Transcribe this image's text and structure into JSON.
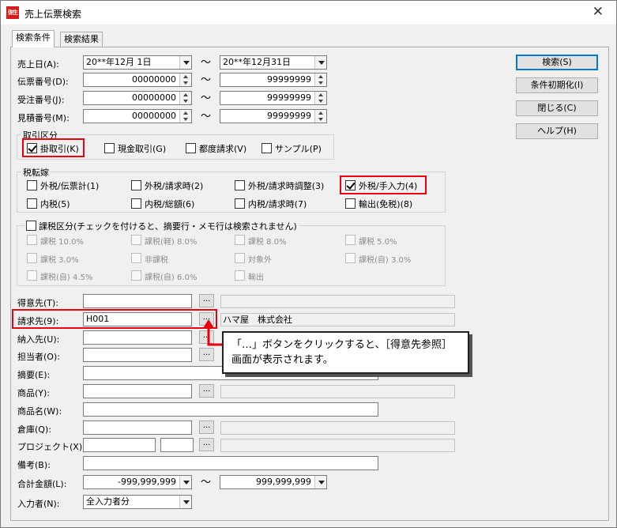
{
  "window": {
    "title": "売上伝票検索",
    "app_icon_text": "弥生",
    "close_symbol": "✕"
  },
  "tabs": [
    {
      "label": "検索条件",
      "active": true
    },
    {
      "label": "検索結果",
      "active": false
    }
  ],
  "range_fields": [
    {
      "label": "売上日(A):",
      "from": "20**年12月 1日",
      "to": "20**年12月31日",
      "type": "combo"
    },
    {
      "label": "伝票番号(D):",
      "from": "00000000",
      "to": "99999999",
      "type": "spin"
    },
    {
      "label": "受注番号(J):",
      "from": "00000000",
      "to": "99999999",
      "type": "spin"
    },
    {
      "label": "見積番号(M):",
      "from": "00000000",
      "to": "99999999",
      "type": "spin"
    }
  ],
  "tilde": "〜",
  "buttons": {
    "search": "検索(S)",
    "reset": "条件初期化(I)",
    "close": "閉じる(C)",
    "help": "ヘルプ(H)"
  },
  "trade_type": {
    "title": "取引区分",
    "options": [
      {
        "label": "掛取引(K)",
        "checked": true
      },
      {
        "label": "現金取引(G)",
        "checked": false
      },
      {
        "label": "都度請求(V)",
        "checked": false
      },
      {
        "label": "サンプル(P)",
        "checked": false
      }
    ]
  },
  "tax_transfer": {
    "title": "税転嫁",
    "options": [
      {
        "label": "外税/伝票計(1)",
        "checked": false
      },
      {
        "label": "外税/請求時(2)",
        "checked": false
      },
      {
        "label": "外税/請求時調整(3)",
        "checked": false
      },
      {
        "label": "外税/手入力(4)",
        "checked": true
      },
      {
        "label": "内税(5)",
        "checked": false
      },
      {
        "label": "内税/総額(6)",
        "checked": false
      },
      {
        "label": "内税/請求時(7)",
        "checked": false
      },
      {
        "label": "輸出(免税)(8)",
        "checked": false
      }
    ]
  },
  "tax_class": {
    "title": "課税区分(チェックを付けると、摘要行・メモ行は検索されません)",
    "checked": false,
    "options": [
      "課税 10.0%",
      "課税(軽) 8.0%",
      "課税 8.0%",
      "課税 5.0%",
      "課税 3.0%",
      "非課税",
      "対象外",
      "課税(自) 3.0%",
      "課税(自) 4.5%",
      "課税(自) 6.0%",
      "輸出"
    ]
  },
  "lookup_fields": {
    "tokuisaki": {
      "label": "得意先(T):",
      "value": "",
      "name": ""
    },
    "seikyusaki": {
      "label": "請求先(9):",
      "value": "H001",
      "name": "ハマ屋　株式会社"
    },
    "nounyusaki": {
      "label": "納入先(U):",
      "value": ""
    },
    "tantosha": {
      "label": "担当者(O):",
      "value": ""
    },
    "tekiyo": {
      "label": "摘要(E):",
      "value": ""
    },
    "shohin": {
      "label": "商品(Y):",
      "value": ""
    },
    "shohinmei": {
      "label": "商品名(W):",
      "value": ""
    },
    "soko": {
      "label": "倉庫(Q):",
      "value": ""
    },
    "project": {
      "label": "プロジェクト(X):",
      "value": ""
    },
    "biko": {
      "label": "備考(B):",
      "value": ""
    }
  },
  "ellipsis": "...",
  "total": {
    "label": "合計金額(L):",
    "from": "-999,999,999",
    "to": "999,999,999"
  },
  "inputter": {
    "label": "入力者(N):",
    "value": "全入力者分"
  },
  "callout": {
    "line1": "「…」ボタンをクリックすると、［得意先参照］",
    "line2": "画面が表示されます。"
  },
  "colors": {
    "highlight": "#e60012",
    "accent": "#0078d7"
  }
}
